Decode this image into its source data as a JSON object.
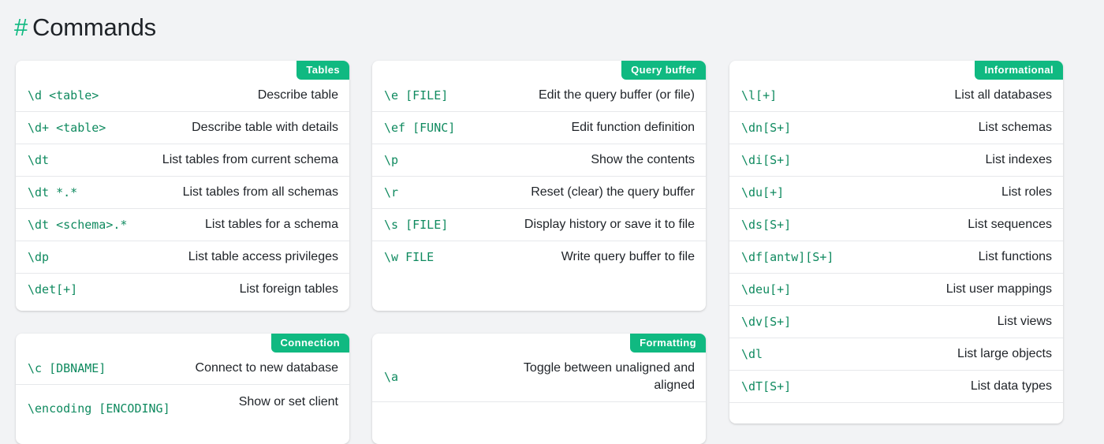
{
  "heading": {
    "hash": "#",
    "title": "Commands"
  },
  "cards": {
    "tables": {
      "tag": "Tables",
      "rows": [
        {
          "cmd": "\\d <table>",
          "desc": "Describe table"
        },
        {
          "cmd": "\\d+ <table>",
          "desc": "Describe table with details"
        },
        {
          "cmd": "\\dt",
          "desc": "List tables from current schema"
        },
        {
          "cmd": "\\dt *.*",
          "desc": "List tables from all schemas"
        },
        {
          "cmd": "\\dt <schema>.*",
          "desc": "List tables for a schema"
        },
        {
          "cmd": "\\dp",
          "desc": "List table access privileges"
        },
        {
          "cmd": "\\det[+]",
          "desc": "List foreign tables"
        }
      ]
    },
    "query_buffer": {
      "tag": "Query buffer",
      "rows": [
        {
          "cmd": "\\e [FILE]",
          "desc": "Edit the query buffer (or file)"
        },
        {
          "cmd": "\\ef [FUNC]",
          "desc": "Edit function definition"
        },
        {
          "cmd": "\\p",
          "desc": "Show the contents"
        },
        {
          "cmd": "\\r",
          "desc": "Reset (clear) the query buffer"
        },
        {
          "cmd": "\\s [FILE]",
          "desc": "Display history or save it to file"
        },
        {
          "cmd": "\\w FILE",
          "desc": "Write query buffer to file"
        }
      ]
    },
    "informational": {
      "tag": "Informational",
      "rows": [
        {
          "cmd": "\\l[+]",
          "desc": "List all databases"
        },
        {
          "cmd": "\\dn[S+]",
          "desc": "List schemas"
        },
        {
          "cmd": "\\di[S+]",
          "desc": "List indexes"
        },
        {
          "cmd": "\\du[+]",
          "desc": "List roles"
        },
        {
          "cmd": "\\ds[S+]",
          "desc": "List sequences"
        },
        {
          "cmd": "\\df[antw][S+]",
          "desc": "List functions"
        },
        {
          "cmd": "\\deu[+]",
          "desc": "List user mappings"
        },
        {
          "cmd": "\\dv[S+]",
          "desc": "List views"
        },
        {
          "cmd": "\\dl",
          "desc": "List large objects"
        },
        {
          "cmd": "\\dT[S+]",
          "desc": "List data types"
        }
      ]
    },
    "connection": {
      "tag": "Connection",
      "rows": [
        {
          "cmd": "\\c [DBNAME]",
          "desc": "Connect to new database"
        },
        {
          "cmd": "\\encoding [ENCODING]",
          "desc": "Show or set client"
        }
      ]
    },
    "formatting": {
      "tag": "Formatting",
      "rows": [
        {
          "cmd": "\\a",
          "desc": "Toggle between unaligned and aligned"
        }
      ]
    }
  }
}
